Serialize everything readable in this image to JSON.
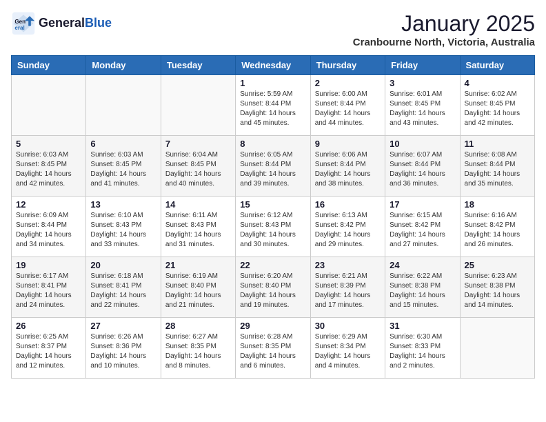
{
  "header": {
    "logo_general": "General",
    "logo_blue": "Blue",
    "month": "January 2025",
    "location": "Cranbourne North, Victoria, Australia"
  },
  "days_of_week": [
    "Sunday",
    "Monday",
    "Tuesday",
    "Wednesday",
    "Thursday",
    "Friday",
    "Saturday"
  ],
  "weeks": [
    [
      {
        "day": "",
        "info": ""
      },
      {
        "day": "",
        "info": ""
      },
      {
        "day": "",
        "info": ""
      },
      {
        "day": "1",
        "info": "Sunrise: 5:59 AM\nSunset: 8:44 PM\nDaylight: 14 hours\nand 45 minutes."
      },
      {
        "day": "2",
        "info": "Sunrise: 6:00 AM\nSunset: 8:44 PM\nDaylight: 14 hours\nand 44 minutes."
      },
      {
        "day": "3",
        "info": "Sunrise: 6:01 AM\nSunset: 8:45 PM\nDaylight: 14 hours\nand 43 minutes."
      },
      {
        "day": "4",
        "info": "Sunrise: 6:02 AM\nSunset: 8:45 PM\nDaylight: 14 hours\nand 42 minutes."
      }
    ],
    [
      {
        "day": "5",
        "info": "Sunrise: 6:03 AM\nSunset: 8:45 PM\nDaylight: 14 hours\nand 42 minutes."
      },
      {
        "day": "6",
        "info": "Sunrise: 6:03 AM\nSunset: 8:45 PM\nDaylight: 14 hours\nand 41 minutes."
      },
      {
        "day": "7",
        "info": "Sunrise: 6:04 AM\nSunset: 8:45 PM\nDaylight: 14 hours\nand 40 minutes."
      },
      {
        "day": "8",
        "info": "Sunrise: 6:05 AM\nSunset: 8:44 PM\nDaylight: 14 hours\nand 39 minutes."
      },
      {
        "day": "9",
        "info": "Sunrise: 6:06 AM\nSunset: 8:44 PM\nDaylight: 14 hours\nand 38 minutes."
      },
      {
        "day": "10",
        "info": "Sunrise: 6:07 AM\nSunset: 8:44 PM\nDaylight: 14 hours\nand 36 minutes."
      },
      {
        "day": "11",
        "info": "Sunrise: 6:08 AM\nSunset: 8:44 PM\nDaylight: 14 hours\nand 35 minutes."
      }
    ],
    [
      {
        "day": "12",
        "info": "Sunrise: 6:09 AM\nSunset: 8:44 PM\nDaylight: 14 hours\nand 34 minutes."
      },
      {
        "day": "13",
        "info": "Sunrise: 6:10 AM\nSunset: 8:43 PM\nDaylight: 14 hours\nand 33 minutes."
      },
      {
        "day": "14",
        "info": "Sunrise: 6:11 AM\nSunset: 8:43 PM\nDaylight: 14 hours\nand 31 minutes."
      },
      {
        "day": "15",
        "info": "Sunrise: 6:12 AM\nSunset: 8:43 PM\nDaylight: 14 hours\nand 30 minutes."
      },
      {
        "day": "16",
        "info": "Sunrise: 6:13 AM\nSunset: 8:42 PM\nDaylight: 14 hours\nand 29 minutes."
      },
      {
        "day": "17",
        "info": "Sunrise: 6:15 AM\nSunset: 8:42 PM\nDaylight: 14 hours\nand 27 minutes."
      },
      {
        "day": "18",
        "info": "Sunrise: 6:16 AM\nSunset: 8:42 PM\nDaylight: 14 hours\nand 26 minutes."
      }
    ],
    [
      {
        "day": "19",
        "info": "Sunrise: 6:17 AM\nSunset: 8:41 PM\nDaylight: 14 hours\nand 24 minutes."
      },
      {
        "day": "20",
        "info": "Sunrise: 6:18 AM\nSunset: 8:41 PM\nDaylight: 14 hours\nand 22 minutes."
      },
      {
        "day": "21",
        "info": "Sunrise: 6:19 AM\nSunset: 8:40 PM\nDaylight: 14 hours\nand 21 minutes."
      },
      {
        "day": "22",
        "info": "Sunrise: 6:20 AM\nSunset: 8:40 PM\nDaylight: 14 hours\nand 19 minutes."
      },
      {
        "day": "23",
        "info": "Sunrise: 6:21 AM\nSunset: 8:39 PM\nDaylight: 14 hours\nand 17 minutes."
      },
      {
        "day": "24",
        "info": "Sunrise: 6:22 AM\nSunset: 8:38 PM\nDaylight: 14 hours\nand 15 minutes."
      },
      {
        "day": "25",
        "info": "Sunrise: 6:23 AM\nSunset: 8:38 PM\nDaylight: 14 hours\nand 14 minutes."
      }
    ],
    [
      {
        "day": "26",
        "info": "Sunrise: 6:25 AM\nSunset: 8:37 PM\nDaylight: 14 hours\nand 12 minutes."
      },
      {
        "day": "27",
        "info": "Sunrise: 6:26 AM\nSunset: 8:36 PM\nDaylight: 14 hours\nand 10 minutes."
      },
      {
        "day": "28",
        "info": "Sunrise: 6:27 AM\nSunset: 8:35 PM\nDaylight: 14 hours\nand 8 minutes."
      },
      {
        "day": "29",
        "info": "Sunrise: 6:28 AM\nSunset: 8:35 PM\nDaylight: 14 hours\nand 6 minutes."
      },
      {
        "day": "30",
        "info": "Sunrise: 6:29 AM\nSunset: 8:34 PM\nDaylight: 14 hours\nand 4 minutes."
      },
      {
        "day": "31",
        "info": "Sunrise: 6:30 AM\nSunset: 8:33 PM\nDaylight: 14 hours\nand 2 minutes."
      },
      {
        "day": "",
        "info": ""
      }
    ]
  ]
}
